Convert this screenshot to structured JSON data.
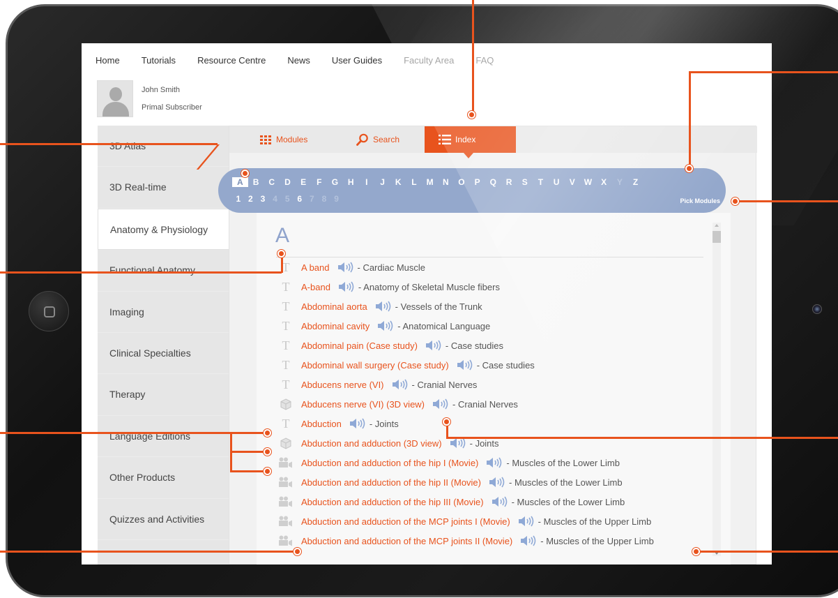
{
  "topnav": {
    "items": [
      "Home",
      "Tutorials",
      "Resource Centre",
      "News",
      "User Guides",
      "Faculty Area",
      "FAQ"
    ]
  },
  "user": {
    "name": "John Smith",
    "role": "Primal Subscriber"
  },
  "sidebar": {
    "items": [
      "3D Atlas",
      "3D Real-time",
      "Anatomy & Physiology",
      "Functional Anatomy",
      "Imaging",
      "Clinical Specialties",
      "Therapy",
      "Language Editions",
      "Other Products",
      "Quizzes and Activities"
    ],
    "active_index": 2
  },
  "tabs": {
    "modules": "Modules",
    "search": "Search",
    "index": "Index",
    "active": "Index"
  },
  "alphabet": {
    "letters": [
      "A",
      "B",
      "C",
      "D",
      "E",
      "F",
      "G",
      "H",
      "I",
      "J",
      "K",
      "L",
      "M",
      "N",
      "O",
      "P",
      "Q",
      "R",
      "S",
      "T",
      "U",
      "V",
      "W",
      "X",
      "Y",
      "Z"
    ],
    "disabled_letters": [
      "Y"
    ],
    "selected_letter": "A",
    "numbers": [
      "1",
      "2",
      "3",
      "4",
      "5",
      "6",
      "7",
      "8",
      "9"
    ],
    "disabled_numbers": [
      "4",
      "5",
      "7",
      "8",
      "9"
    ],
    "pick_modules": "Pick Modules"
  },
  "index": {
    "heading": "A",
    "entries": [
      {
        "type": "text",
        "term": "A band",
        "module": "- Cardiac Muscle"
      },
      {
        "type": "text",
        "term": "A-band",
        "module": "- Anatomy of Skeletal Muscle fibers"
      },
      {
        "type": "text",
        "term": "Abdominal aorta",
        "module": "- Vessels of the Trunk"
      },
      {
        "type": "text",
        "term": "Abdominal cavity",
        "module": "- Anatomical Language"
      },
      {
        "type": "text",
        "term": "Abdominal pain (Case study)",
        "module": "- Case studies"
      },
      {
        "type": "text",
        "term": "Abdominal wall surgery (Case study)",
        "module": "- Case studies"
      },
      {
        "type": "text",
        "term": "Abducens nerve (VI)",
        "module": "- Cranial Nerves"
      },
      {
        "type": "3d",
        "term": "Abducens nerve (VI) (3D view)",
        "module": "- Cranial Nerves"
      },
      {
        "type": "text",
        "term": "Abduction",
        "module": "- Joints"
      },
      {
        "type": "3d",
        "term": "Abduction and adduction (3D view)",
        "module": "- Joints"
      },
      {
        "type": "movie",
        "term": "Abduction and adduction of the hip I (Movie)",
        "module": "- Muscles of the Lower Limb"
      },
      {
        "type": "movie",
        "term": "Abduction and adduction of the hip II (Movie)",
        "module": "- Muscles of the Lower Limb"
      },
      {
        "type": "movie",
        "term": "Abduction and adduction of the hip III (Movie)",
        "module": "- Muscles of the Lower Limb"
      },
      {
        "type": "movie",
        "term": "Abduction and adduction of the MCP joints I (Movie)",
        "module": "- Muscles of the Upper Limb"
      },
      {
        "type": "movie",
        "term": "Abduction and adduction of the MCP joints II (Movie)",
        "module": "- Muscles of the Upper Limb"
      }
    ]
  },
  "colors": {
    "accent": "#e8531d",
    "alpha_bar": "#94a8cc",
    "audio_icon": "#8fa9d6"
  },
  "icons": {
    "text_entry": "text-T-icon",
    "3d_entry": "cube-icon",
    "movie_entry": "movie-camera-icon",
    "audio": "speaker-icon",
    "modules_tab": "grid-icon",
    "search_tab": "magnifier-icon",
    "index_tab": "list-icon"
  }
}
